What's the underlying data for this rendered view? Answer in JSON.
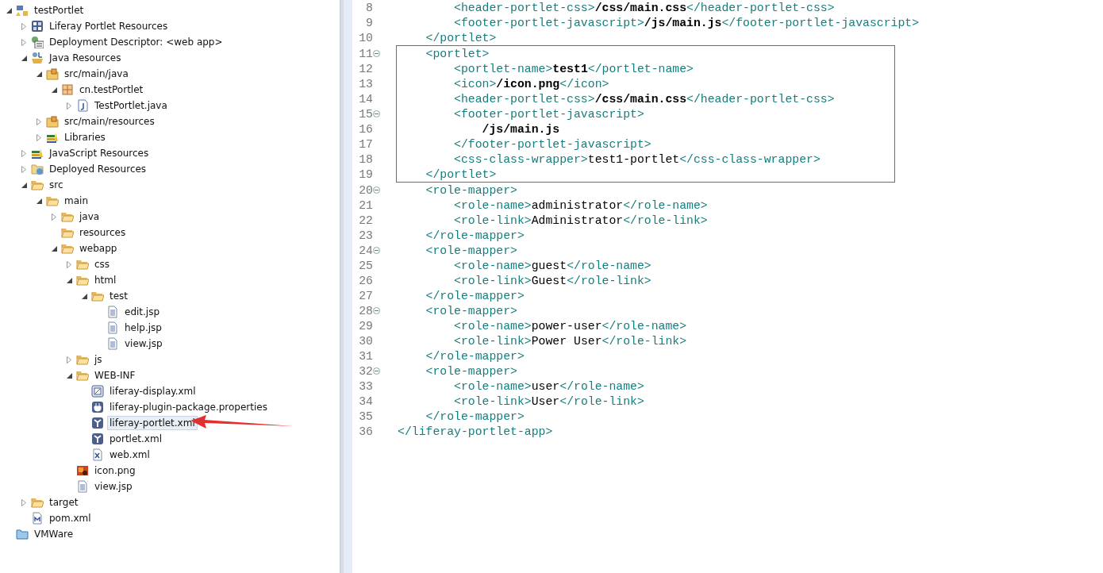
{
  "project_tree": [
    {
      "label": "testPortlet",
      "kind": "project",
      "expanded": true,
      "selected": false,
      "children": [
        {
          "label": "Liferay Portlet Resources",
          "kind": "grid",
          "expanded": false,
          "selected": false
        },
        {
          "label": "Deployment Descriptor: <web app>",
          "kind": "descriptor",
          "expanded": false,
          "selected": false
        },
        {
          "label": "Java Resources",
          "kind": "java-resources",
          "expanded": true,
          "selected": false,
          "children": [
            {
              "label": "src/main/java",
              "kind": "source-folder",
              "expanded": true,
              "selected": false,
              "children": [
                {
                  "label": "cn.testPortlet",
                  "kind": "package",
                  "expanded": true,
                  "selected": false,
                  "children": [
                    {
                      "label": "TestPortlet.java",
                      "kind": "java-file",
                      "expanded": false,
                      "selected": false
                    }
                  ]
                }
              ]
            },
            {
              "label": "src/main/resources",
              "kind": "source-folder",
              "expanded": false,
              "selected": false
            },
            {
              "label": "Libraries",
              "kind": "library",
              "expanded": false,
              "selected": false
            }
          ]
        },
        {
          "label": "JavaScript Resources",
          "kind": "library",
          "expanded": false,
          "selected": false
        },
        {
          "label": "Deployed Resources",
          "kind": "deployed",
          "expanded": false,
          "selected": false
        },
        {
          "label": "src",
          "kind": "folder",
          "expanded": true,
          "selected": false,
          "children": [
            {
              "label": "main",
              "kind": "folder",
              "expanded": true,
              "selected": false,
              "children": [
                {
                  "label": "java",
                  "kind": "folder",
                  "expanded": false,
                  "selected": false
                },
                {
                  "label": "resources",
                  "kind": "folder",
                  "selected": false
                },
                {
                  "label": "webapp",
                  "kind": "folder",
                  "expanded": true,
                  "selected": false,
                  "children": [
                    {
                      "label": "css",
                      "kind": "folder",
                      "expanded": false,
                      "selected": false
                    },
                    {
                      "label": "html",
                      "kind": "folder",
                      "expanded": true,
                      "selected": false,
                      "children": [
                        {
                          "label": "test",
                          "kind": "folder",
                          "expanded": true,
                          "selected": false,
                          "children": [
                            {
                              "label": "edit.jsp",
                              "kind": "text-file",
                              "selected": false
                            },
                            {
                              "label": "help.jsp",
                              "kind": "text-file",
                              "selected": false
                            },
                            {
                              "label": "view.jsp",
                              "kind": "text-file",
                              "selected": false
                            }
                          ]
                        }
                      ]
                    },
                    {
                      "label": "js",
                      "kind": "folder",
                      "expanded": false,
                      "selected": false
                    },
                    {
                      "label": "WEB-INF",
                      "kind": "folder",
                      "expanded": true,
                      "selected": false,
                      "children": [
                        {
                          "label": "liferay-display.xml",
                          "kind": "display-xml",
                          "selected": false
                        },
                        {
                          "label": "liferay-plugin-package.properties",
                          "kind": "plug",
                          "selected": false
                        },
                        {
                          "label": "liferay-portlet.xml",
                          "kind": "portlet-xml",
                          "selected": true,
                          "pointed": true
                        },
                        {
                          "label": "portlet.xml",
                          "kind": "portlet-xml",
                          "selected": false
                        },
                        {
                          "label": "web.xml",
                          "kind": "xml-file",
                          "selected": false
                        }
                      ]
                    },
                    {
                      "label": "icon.png",
                      "kind": "image-file",
                      "selected": false
                    },
                    {
                      "label": "view.jsp",
                      "kind": "text-file",
                      "selected": false
                    }
                  ]
                }
              ]
            }
          ]
        },
        {
          "label": "target",
          "kind": "folder",
          "expanded": false,
          "selected": false
        },
        {
          "label": "pom.xml",
          "kind": "maven-file",
          "selected": false
        }
      ]
    },
    {
      "label": "VMWare",
      "kind": "working-set",
      "selected": false
    }
  ],
  "editor": {
    "lines": [
      {
        "number": "8",
        "foldable": false,
        "boxed": false,
        "segments": [
          {
            "kind": "tag",
            "text": "        <header-portlet-css>"
          },
          {
            "kind": "value",
            "text": "/css/main.css"
          },
          {
            "kind": "tag",
            "text": "</header-portlet-css>"
          }
        ]
      },
      {
        "number": "9",
        "foldable": false,
        "boxed": false,
        "segments": [
          {
            "kind": "tag",
            "text": "        <footer-portlet-javascript>"
          },
          {
            "kind": "value",
            "text": "/js/main.js"
          },
          {
            "kind": "tag",
            "text": "</footer-portlet-javascript>"
          }
        ]
      },
      {
        "number": "10",
        "foldable": false,
        "boxed": false,
        "segments": [
          {
            "kind": "tag",
            "text": "    </portlet>"
          }
        ]
      },
      {
        "number": "11",
        "foldable": true,
        "boxed": true,
        "segments": [
          {
            "kind": "tag",
            "text": "    <portlet>"
          }
        ]
      },
      {
        "number": "12",
        "foldable": false,
        "boxed": true,
        "segments": [
          {
            "kind": "tag",
            "text": "        <portlet-name>"
          },
          {
            "kind": "value",
            "text": "test1"
          },
          {
            "kind": "tag",
            "text": "</portlet-name>"
          }
        ]
      },
      {
        "number": "13",
        "foldable": false,
        "boxed": true,
        "segments": [
          {
            "kind": "tag",
            "text": "        <icon>"
          },
          {
            "kind": "value",
            "text": "/icon.png"
          },
          {
            "kind": "tag",
            "text": "</icon>"
          }
        ]
      },
      {
        "number": "14",
        "foldable": false,
        "boxed": true,
        "segments": [
          {
            "kind": "tag",
            "text": "        <header-portlet-css>"
          },
          {
            "kind": "value",
            "text": "/css/main.css"
          },
          {
            "kind": "tag",
            "text": "</header-portlet-css>"
          }
        ]
      },
      {
        "number": "15",
        "foldable": true,
        "boxed": true,
        "segments": [
          {
            "kind": "tag",
            "text": "        <footer-portlet-javascript>"
          }
        ]
      },
      {
        "number": "16",
        "foldable": false,
        "boxed": true,
        "segments": [
          {
            "kind": "value",
            "text": "            /js/main.js"
          }
        ]
      },
      {
        "number": "17",
        "foldable": false,
        "boxed": true,
        "segments": [
          {
            "kind": "tag",
            "text": "        </footer-portlet-javascript>"
          }
        ]
      },
      {
        "number": "18",
        "foldable": false,
        "boxed": true,
        "segments": [
          {
            "kind": "tag",
            "text": "        <css-class-wrapper>"
          },
          {
            "kind": "text",
            "text": "test1-portlet"
          },
          {
            "kind": "tag",
            "text": "</css-class-wrapper>"
          }
        ]
      },
      {
        "number": "19",
        "foldable": false,
        "boxed": true,
        "segments": [
          {
            "kind": "tag",
            "text": "    </portlet>"
          }
        ]
      },
      {
        "number": "20",
        "foldable": true,
        "boxed": false,
        "segments": [
          {
            "kind": "tag",
            "text": "    <role-mapper>"
          }
        ]
      },
      {
        "number": "21",
        "foldable": false,
        "boxed": false,
        "segments": [
          {
            "kind": "tag",
            "text": "        <role-name>"
          },
          {
            "kind": "text",
            "text": "administrator"
          },
          {
            "kind": "tag",
            "text": "</role-name>"
          }
        ]
      },
      {
        "number": "22",
        "foldable": false,
        "boxed": false,
        "segments": [
          {
            "kind": "tag",
            "text": "        <role-link>"
          },
          {
            "kind": "text",
            "text": "Administrator"
          },
          {
            "kind": "tag",
            "text": "</role-link>"
          }
        ]
      },
      {
        "number": "23",
        "foldable": false,
        "boxed": false,
        "segments": [
          {
            "kind": "tag",
            "text": "    </role-mapper>"
          }
        ]
      },
      {
        "number": "24",
        "foldable": true,
        "boxed": false,
        "segments": [
          {
            "kind": "tag",
            "text": "    <role-mapper>"
          }
        ]
      },
      {
        "number": "25",
        "foldable": false,
        "boxed": false,
        "segments": [
          {
            "kind": "tag",
            "text": "        <role-name>"
          },
          {
            "kind": "text",
            "text": "guest"
          },
          {
            "kind": "tag",
            "text": "</role-name>"
          }
        ]
      },
      {
        "number": "26",
        "foldable": false,
        "boxed": false,
        "segments": [
          {
            "kind": "tag",
            "text": "        <role-link>"
          },
          {
            "kind": "text",
            "text": "Guest"
          },
          {
            "kind": "tag",
            "text": "</role-link>"
          }
        ]
      },
      {
        "number": "27",
        "foldable": false,
        "boxed": false,
        "segments": [
          {
            "kind": "tag",
            "text": "    </role-mapper>"
          }
        ]
      },
      {
        "number": "28",
        "foldable": true,
        "boxed": false,
        "segments": [
          {
            "kind": "tag",
            "text": "    <role-mapper>"
          }
        ]
      },
      {
        "number": "29",
        "foldable": false,
        "boxed": false,
        "segments": [
          {
            "kind": "tag",
            "text": "        <role-name>"
          },
          {
            "kind": "text",
            "text": "power-user"
          },
          {
            "kind": "tag",
            "text": "</role-name>"
          }
        ]
      },
      {
        "number": "30",
        "foldable": false,
        "boxed": false,
        "segments": [
          {
            "kind": "tag",
            "text": "        <role-link>"
          },
          {
            "kind": "text",
            "text": "Power User"
          },
          {
            "kind": "tag",
            "text": "</role-link>"
          }
        ]
      },
      {
        "number": "31",
        "foldable": false,
        "boxed": false,
        "segments": [
          {
            "kind": "tag",
            "text": "    </role-mapper>"
          }
        ]
      },
      {
        "number": "32",
        "foldable": true,
        "boxed": false,
        "segments": [
          {
            "kind": "tag",
            "text": "    <role-mapper>"
          }
        ]
      },
      {
        "number": "33",
        "foldable": false,
        "boxed": false,
        "segments": [
          {
            "kind": "tag",
            "text": "        <role-name>"
          },
          {
            "kind": "text",
            "text": "user"
          },
          {
            "kind": "tag",
            "text": "</role-name>"
          }
        ]
      },
      {
        "number": "34",
        "foldable": false,
        "boxed": false,
        "segments": [
          {
            "kind": "tag",
            "text": "        <role-link>"
          },
          {
            "kind": "text",
            "text": "User"
          },
          {
            "kind": "tag",
            "text": "</role-link>"
          }
        ]
      },
      {
        "number": "35",
        "foldable": false,
        "boxed": false,
        "segments": [
          {
            "kind": "tag",
            "text": "    </role-mapper>"
          }
        ]
      },
      {
        "number": "36",
        "foldable": false,
        "boxed": false,
        "segments": [
          {
            "kind": "tag",
            "text": "</liferay-portlet-app>"
          }
        ]
      }
    ]
  }
}
